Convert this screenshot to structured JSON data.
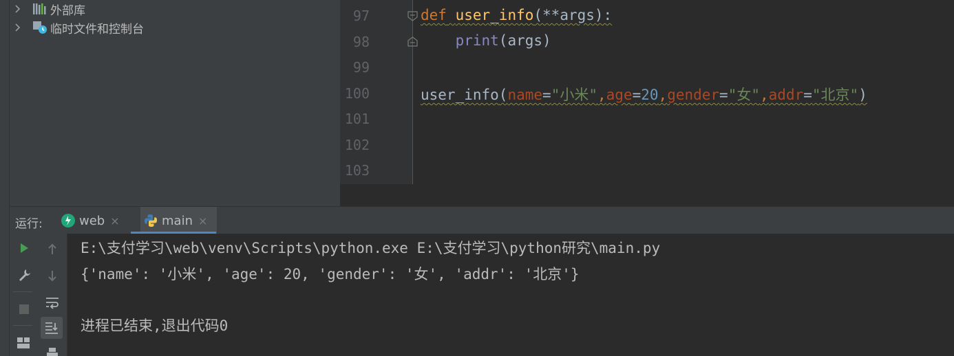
{
  "project_tree": {
    "items": [
      {
        "label": "外部库",
        "icon": "library-icon"
      },
      {
        "label": "临时文件和控制台",
        "icon": "scratches-icon"
      }
    ]
  },
  "editor": {
    "line_numbers": [
      "97",
      "98",
      "99",
      "100",
      "101",
      "102",
      "103"
    ],
    "code": {
      "l97": {
        "kw": "def",
        "space": " ",
        "fn": "user_info",
        "rest": "(**args):"
      },
      "l98": {
        "indent": "    ",
        "builtin": "print",
        "rest": "(args)"
      },
      "l100": {
        "fn_call": "user_info",
        "open": "(",
        "p1": "name",
        "eq1": "=",
        "v1": "\"小米\"",
        "c1": ",",
        "p2": "age",
        "eq2": "=",
        "v2": "20",
        "c2": ",",
        "p3": "gender",
        "eq3": "=",
        "v3": "\"女\"",
        "c3": ",",
        "p4": "addr",
        "eq4": "=",
        "v4": "\"北京\"",
        "close": ")"
      }
    }
  },
  "run_panel": {
    "label": "运行:",
    "tabs": [
      {
        "label": "web",
        "icon": "web-run-icon",
        "close": "×"
      },
      {
        "label": "main",
        "icon": "python-icon",
        "close": "×"
      }
    ],
    "console_lines": [
      "E:\\支付学习\\web\\venv\\Scripts\\python.exe E:\\支付学习\\python研究\\main.py",
      "{'name': '小米', 'age': 20, 'gender': '女', 'addr': '北京'}",
      "",
      "进程已结束,退出代码0"
    ]
  },
  "colors": {
    "keyword": "#cc7832",
    "function": "#ffc66d",
    "builtin": "#8888c6",
    "parameter": "#aa4926",
    "string": "#6a8759",
    "number": "#6897bb",
    "run_green": "#499c54",
    "accent_blue": "#4a88c7"
  }
}
